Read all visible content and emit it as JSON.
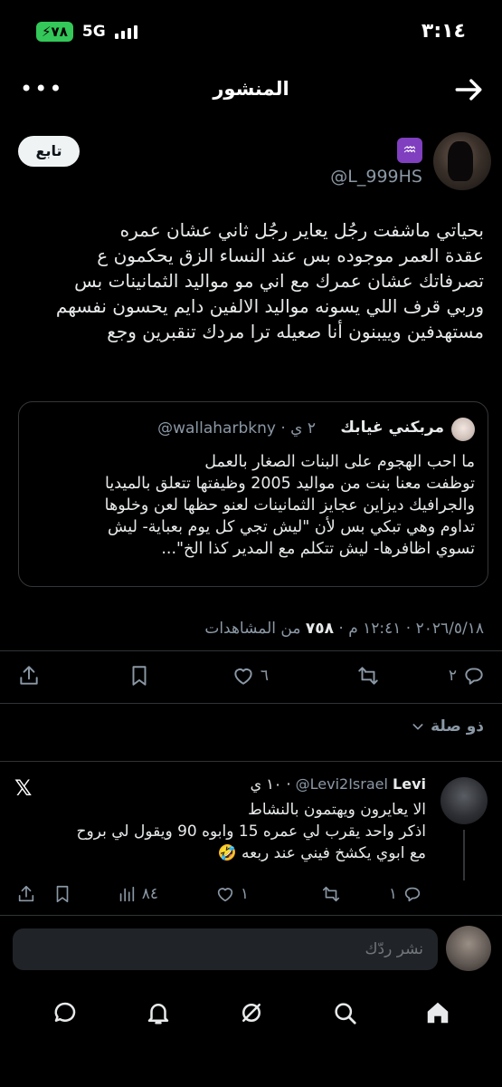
{
  "status_bar": {
    "time": "٣:١٤",
    "battery": "٧٨",
    "network": "5G"
  },
  "header": {
    "title": "المنشور"
  },
  "author": {
    "handle": "@L_999HS",
    "zodiac": "♒",
    "follow_label": "تابع"
  },
  "post": {
    "lines": [
      "بحياتي ماشفت رجُل يعاير رجُل ثاني عشان عمره",
      "عقدة العمر موجوده بس عند النساء الزق يحكمون ع",
      "تصرفاتك عشان عمرك مع اني مو مواليد الثمانينات بس",
      "وربي قرف اللي يسونه مواليد الالفين دايم يحسون نفسهم",
      "مستهدفين  وييبنون أنا صعيله ترا مردك تنقبرين وجع"
    ],
    "meta_date": "٢٠٢٦/٥/١٨ · ١٢:٤١ م · ",
    "meta_views": "٧٥٨",
    "meta_views_label": " من المشاهدات"
  },
  "quote": {
    "name": "مربكني غيابك",
    "handle": "@wallaharbkny",
    "time": "· ٢ ي",
    "lines": [
      "ما احب الهجوم على البنات الصغار بالعمل",
      "توظفت معنا بنت من مواليد 2005 وظيفتها تتعلق بالميديا",
      "والجرافيك ديزاين عجايز الثمانينات لعنو حظها لعن وخلوها",
      "تداوم وهي تبكي بس لأن \"ليش تجي كل يوم بعباية- ليش",
      "تسوي اظافرها- ليش تتكلم مع المدير كذا الخ\"..."
    ]
  },
  "actions": {
    "replies": "٢",
    "likes": "٦"
  },
  "related_label": "ذو صلة",
  "reply": {
    "name": "Levi",
    "handle": "@Levi2Israel",
    "time": "١٠ ي",
    "lines": [
      "الا يعايرون ويهتمون بالنشاط",
      "اذكر واحد يقرب لي عمره 15 وابوه 90 ويقول لي بروح",
      "مع ابوي يكشخ فيني عند ربعه 🤣"
    ],
    "replies": "١",
    "likes": "١",
    "views": "٨٤"
  },
  "composer": {
    "placeholder": "نشر ردّك"
  },
  "nav": [
    "home-icon",
    "search-icon",
    "grok-icon",
    "notifications-icon",
    "messages-icon"
  ]
}
